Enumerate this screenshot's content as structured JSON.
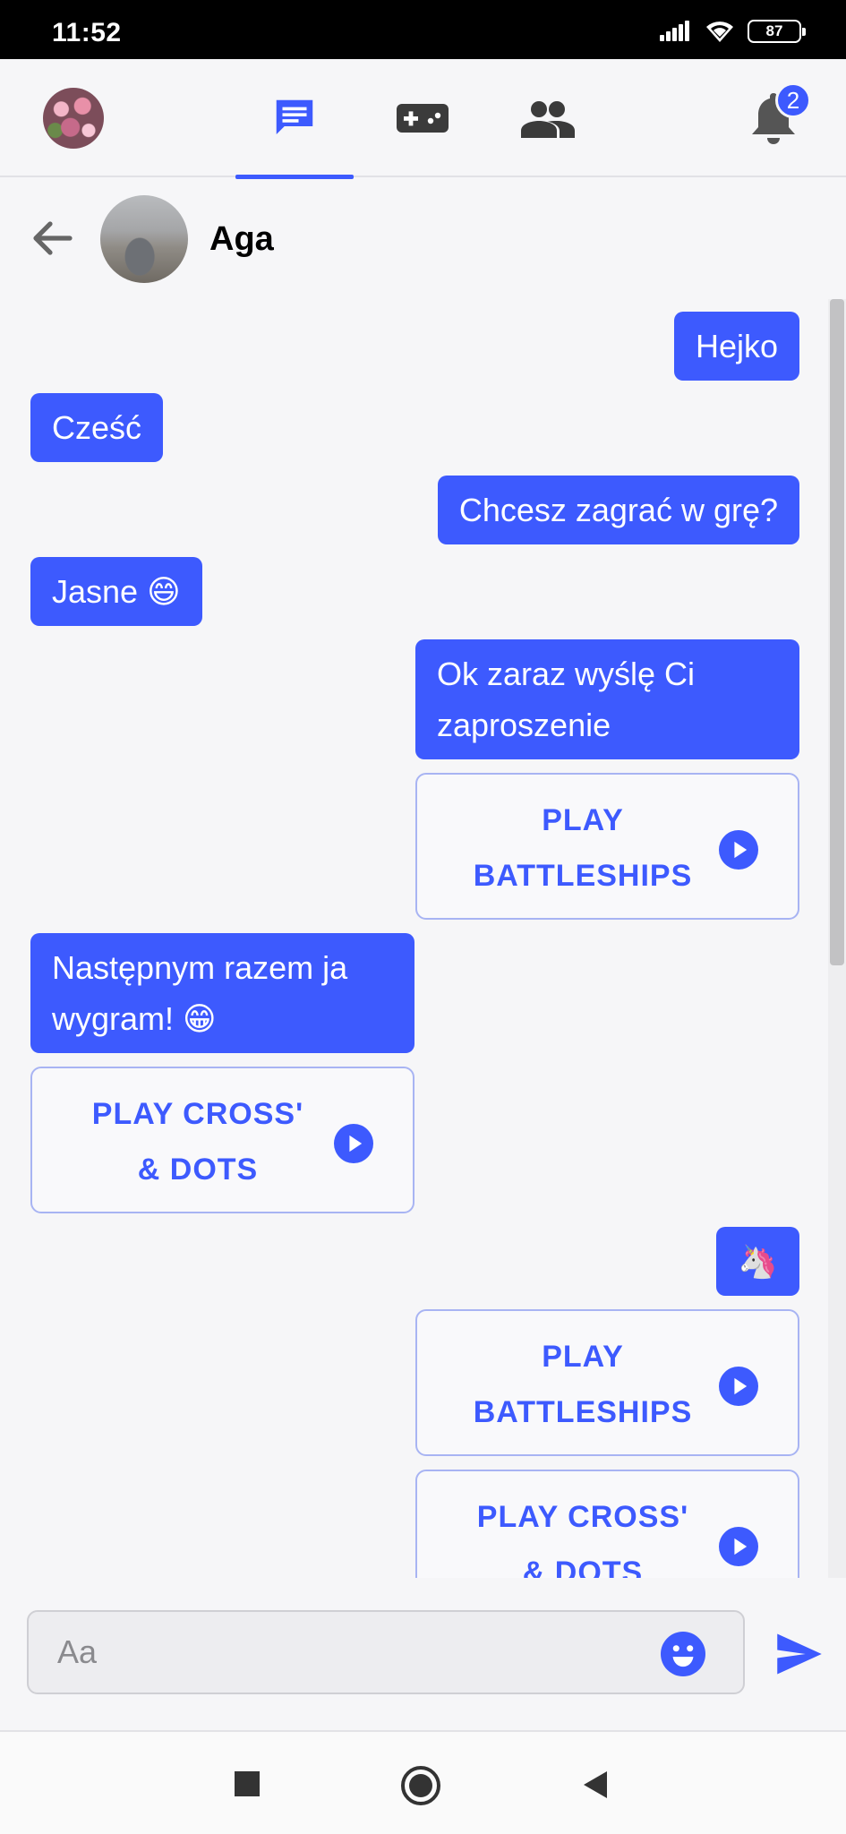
{
  "status_bar": {
    "time": "11:52",
    "battery": "87"
  },
  "top_nav": {
    "tabs": [
      "chat-icon",
      "gamepad-icon",
      "friends-icon"
    ],
    "active_tab": "chat",
    "notifications_count": "2"
  },
  "chat_header": {
    "contact_name": "Aga"
  },
  "messages": [
    {
      "direction": "out",
      "text": "Hejko"
    },
    {
      "direction": "in",
      "text": "Cześć"
    },
    {
      "direction": "out",
      "text": "Chcesz zagrać w grę?"
    },
    {
      "direction": "in",
      "text": "Jasne 😄"
    },
    {
      "direction": "out",
      "text": "Ok zaraz wyślę Ci zaproszenie"
    },
    {
      "direction": "out",
      "type": "game",
      "text": "PLAY\nBATTLESHIPS"
    },
    {
      "direction": "in",
      "text": "Następnym razem ja wygram! 😁"
    },
    {
      "direction": "in",
      "type": "game",
      "text": "PLAY CROSS'\n& DOTS"
    },
    {
      "direction": "out",
      "text": "🦄"
    },
    {
      "direction": "out",
      "type": "game",
      "text": "PLAY\nBATTLESHIPS"
    },
    {
      "direction": "out",
      "type": "game",
      "text": "PLAY CROSS'\n& DOTS"
    }
  ],
  "composer": {
    "placeholder": "Aa"
  },
  "colors": {
    "accent": "#3d5afe",
    "background": "#f6f6f8"
  }
}
